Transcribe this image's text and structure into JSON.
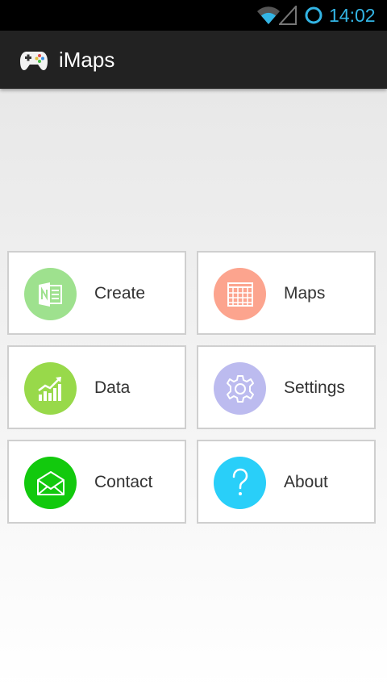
{
  "status_bar": {
    "time": "14:02",
    "accent_color": "#33b5e5"
  },
  "action_bar": {
    "title": "iMaps",
    "icon": "gamepad-icon"
  },
  "menu": [
    {
      "label": "Create",
      "icon": "onenote-icon",
      "color": "#9ee18e"
    },
    {
      "label": "Maps",
      "icon": "calendar-icon",
      "color": "#fca48e"
    },
    {
      "label": "Data",
      "icon": "chart-icon",
      "color": "#98d94a"
    },
    {
      "label": "Settings",
      "icon": "gear-icon",
      "color": "#bcbbef"
    },
    {
      "label": "Contact",
      "icon": "envelope-icon",
      "color": "#12c90d"
    },
    {
      "label": "About",
      "icon": "question-icon",
      "color": "#29cff9"
    }
  ]
}
